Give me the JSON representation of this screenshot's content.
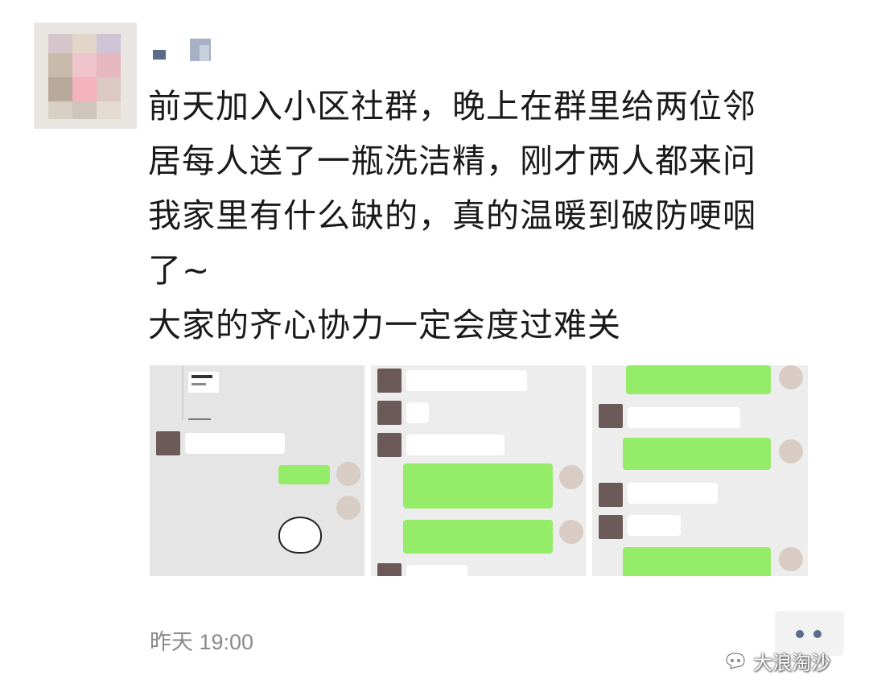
{
  "post": {
    "lines": [
      "前天加入小区社群，晚上在群里给两位邻",
      "居每人送了一瓶洗洁精，刚才两人都来问",
      "我家里有什么缺的，真的温暖到破防哽咽",
      "了~",
      "大家的齐心协力一定会度过难关"
    ],
    "time": "昨天 19:00"
  },
  "watermark": {
    "text": "大浪淘沙",
    "icon": "wechat-channel-icon"
  },
  "colors": {
    "text": "#1a1a1a",
    "timestamp": "#8a8a8a",
    "nickname": "#5a6b8c",
    "bubble_green": "#95ec69",
    "bubble_white": "#ffffff"
  }
}
